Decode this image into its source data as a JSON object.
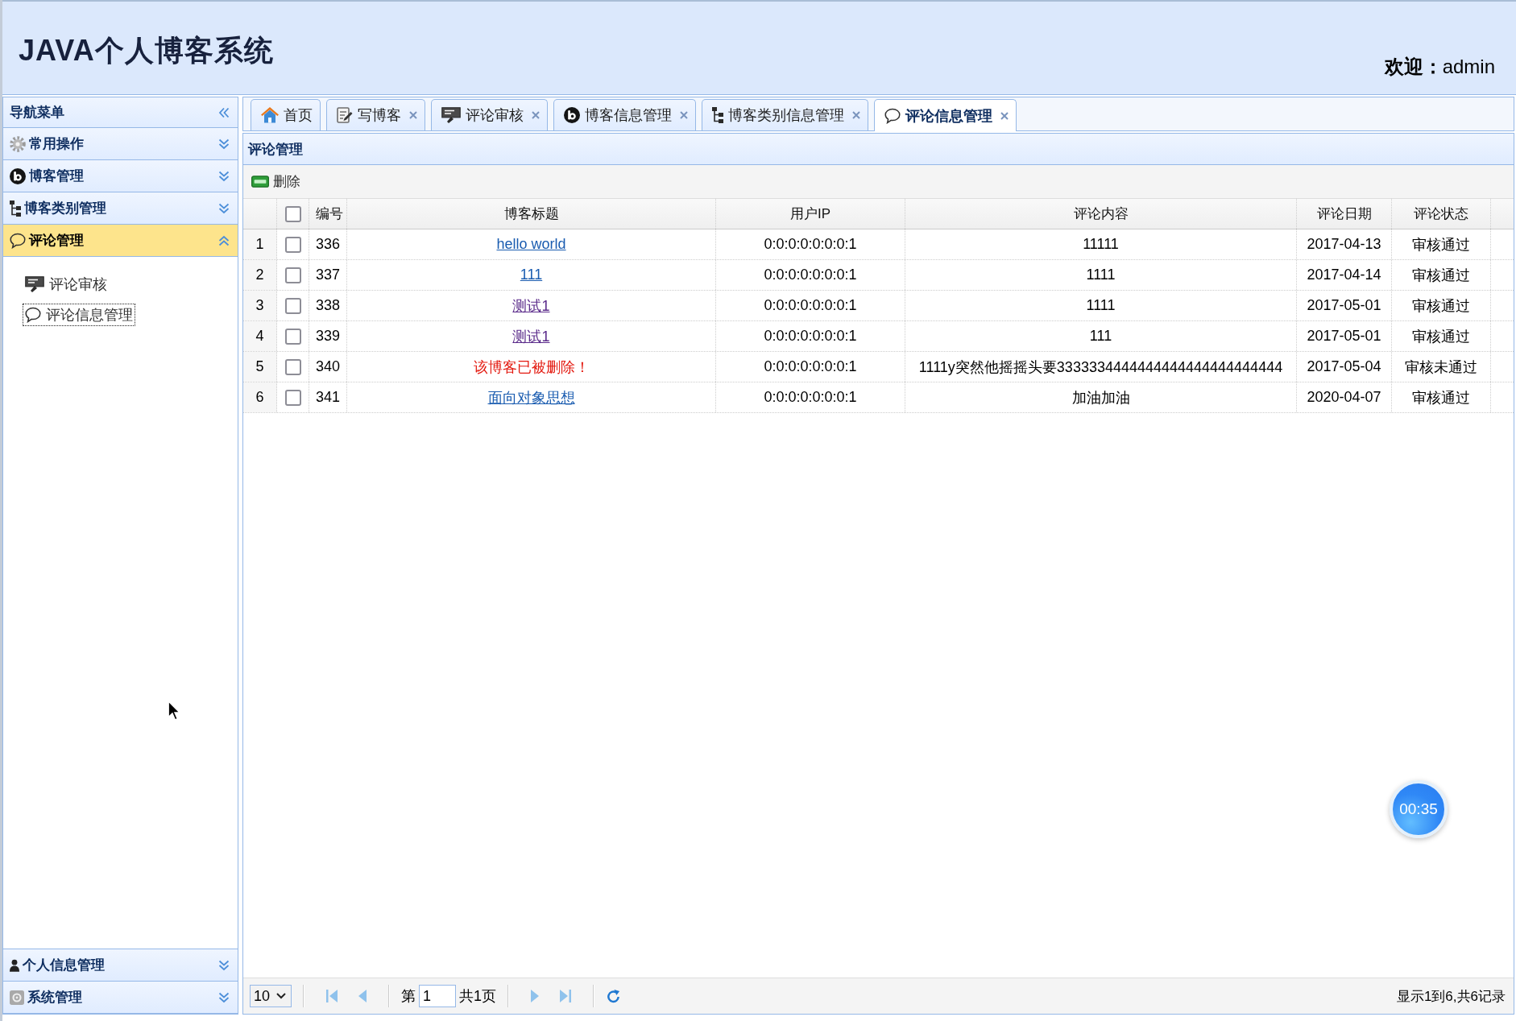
{
  "header": {
    "title": "JAVA个人博客系统",
    "welcome": "**欢迎：**admin"
  },
  "sidebar": {
    "title": "导航菜单",
    "sections": [
      {
        "label": "常用操作",
        "expanded": false
      },
      {
        "label": "博客管理",
        "expanded": false
      },
      {
        "label": "博客类别管理",
        "expanded": false
      },
      {
        "label": "评论管理",
        "expanded": true,
        "items": [
          {
            "label": "评论审核",
            "selected": false
          },
          {
            "label": "评论信息管理",
            "selected": true
          }
        ]
      },
      {
        "label": "个人信息管理",
        "expanded": false
      },
      {
        "label": "系统管理",
        "expanded": false
      }
    ]
  },
  "tabs": [
    {
      "label": "首页",
      "closable": false,
      "selected": false
    },
    {
      "label": "写博客",
      "closable": true,
      "selected": false
    },
    {
      "label": "评论审核",
      "closable": true,
      "selected": false
    },
    {
      "label": "博客信息管理",
      "closable": true,
      "selected": false
    },
    {
      "label": "博客类别信息管理",
      "closable": true,
      "selected": false
    },
    {
      "label": "评论信息管理",
      "closable": true,
      "selected": true
    }
  ],
  "panel": {
    "title": "评论管理",
    "toolbar": [
      {
        "label": "删除"
      }
    ],
    "table": {
      "select_all": false,
      "columns": [
        "编号",
        "博客标题",
        "用户IP",
        "评论内容",
        "评论日期",
        "评论状态"
      ],
      "rows": [
        {
          "row_number": "1",
          "checked": false,
          "id": "336",
          "title": {
            "text": "hello world",
            "kind": "link",
            "visited": false
          },
          "user_ip": "0:0:0:0:0:0:0:1",
          "content": "11111",
          "date": "2017-04-13",
          "status": "审核通过"
        },
        {
          "row_number": "2",
          "checked": false,
          "id": "337",
          "title": {
            "text": "111",
            "kind": "link",
            "visited": false
          },
          "user_ip": "0:0:0:0:0:0:0:1",
          "content": "1111",
          "date": "2017-04-14",
          "status": "审核通过"
        },
        {
          "row_number": "3",
          "checked": false,
          "id": "338",
          "title": {
            "text": "测试1",
            "kind": "link",
            "visited": true
          },
          "user_ip": "0:0:0:0:0:0:0:1",
          "content": "1111",
          "date": "2017-05-01",
          "status": "审核通过"
        },
        {
          "row_number": "4",
          "checked": false,
          "id": "339",
          "title": {
            "text": "测试1",
            "kind": "link",
            "visited": true
          },
          "user_ip": "0:0:0:0:0:0:0:1",
          "content": "111",
          "date": "2017-05-01",
          "status": "审核通过"
        },
        {
          "row_number": "5",
          "checked": false,
          "id": "340",
          "title": {
            "text": "该博客已被删除！",
            "kind": "deleted"
          },
          "user_ip": "0:0:0:0:0:0:0:1",
          "content": "1111y突然他摇摇头要3333334444444444444444444444",
          "date": "2017-05-04",
          "status": "审核未通过"
        },
        {
          "row_number": "6",
          "checked": false,
          "id": "341",
          "title": {
            "text": "面向对象思想",
            "kind": "link",
            "visited": false
          },
          "user_ip": "0:0:0:0:0:0:0:1",
          "content": "加油加油",
          "date": "2020-04-07",
          "status": "审核通过"
        }
      ]
    }
  },
  "pager": {
    "page_size": "10",
    "first_page": {
      "disabled": true
    },
    "prev_page": {
      "disabled": true
    },
    "page_label": "第",
    "page": "1",
    "page_total": "共1页",
    "next_page": {
      "disabled": true
    },
    "last_page": {
      "disabled": true
    },
    "info": "显示1到6,共6记录"
  },
  "recording_timer": "00:35"
}
